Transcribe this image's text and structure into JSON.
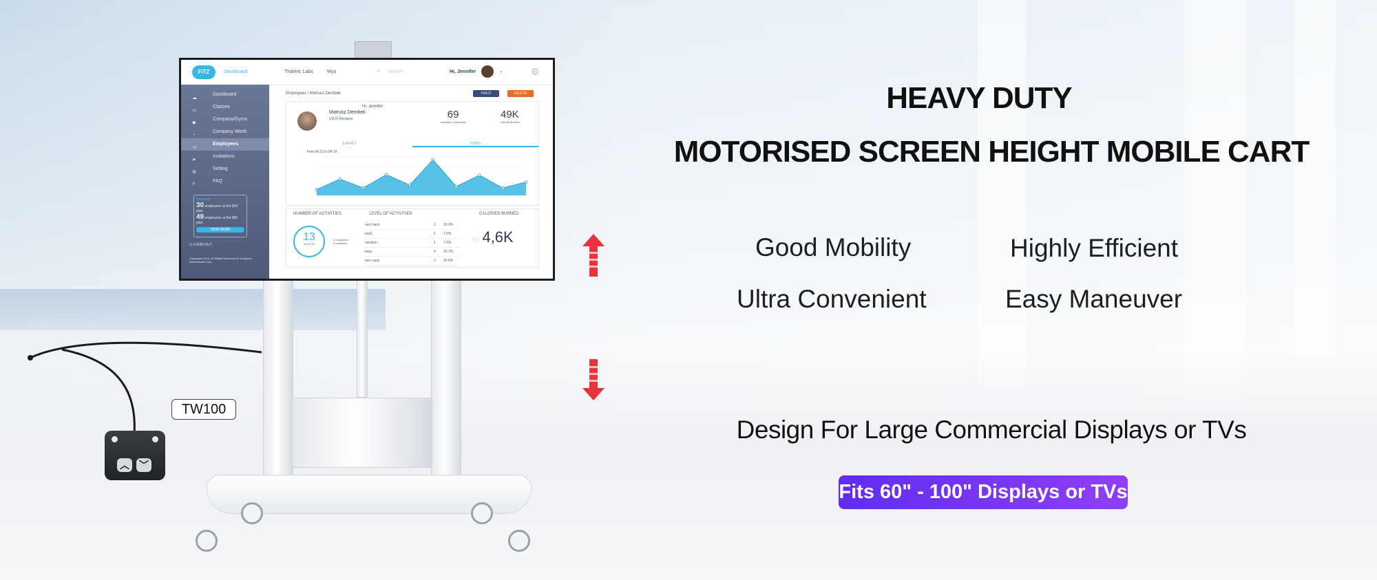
{
  "headline": {
    "line1": "HEAVY DUTY",
    "line2": "MOTORISED SCREEN HEIGHT MOBILE  CART"
  },
  "features": [
    "Good Mobility",
    "Highly Efficient",
    "Ultra Convenient",
    "Easy Maneuver"
  ],
  "design_text": "Design  For Large Commercial Displays or TVs",
  "badge_text": "Fits 60\" - 100\" Displays or TVs",
  "model_label": "TW100",
  "colors": {
    "arrow": "#e8323c",
    "badge": "#6a33f2",
    "accent": "#39b6e3"
  },
  "screen_ui": {
    "logo": "FITZ",
    "top_nav": {
      "dashboard": "Dashboard",
      "company": "Thalmic Labs",
      "company_suffix": "Myo",
      "search": "Search",
      "greeting": "Hi, Jennifer"
    },
    "sidebar": [
      "Dashboard",
      "Classes",
      "Company/Gyms",
      "Company Week",
      "Employees",
      "Invitations",
      "Setting",
      "FAQ"
    ],
    "plan": {
      "title": "Your plan",
      "count1": "30",
      "text1": "employees at the $50 plan",
      "count2": "49",
      "text2": "employees at the $50 plan",
      "button": "VIEW MORE"
    },
    "logout": "LOGIN OUT",
    "footer": "Copyrights 2015. All Rights Reserved by Energized International Corp.",
    "breadcrumb": "Employees / Matrusz Dembek",
    "buttons": {
      "hold": "HOLD",
      "delete": "DELETE"
    },
    "profile": {
      "greeting": "Hi, Jennifer",
      "name": "Matrusz Dembek",
      "role": "UI/UX Designer"
    },
    "kpis": [
      {
        "value": "69",
        "label": "Activities Completed"
      },
      {
        "value": "49K",
        "label": "Calories Burned"
      }
    ],
    "tabs": [
      "SURVEY",
      "STATS"
    ],
    "range": "from 04.13 to 04.19",
    "chart_values": [
      20,
      55,
      25,
      70,
      35,
      120,
      30,
      68,
      25,
      45
    ],
    "sections": [
      "NUMBER OF ACTIVITIES",
      "LEVEL OF ACTIVITIES",
      "CALORIES BURNED"
    ],
    "ring": {
      "value": "13",
      "sub": "out of 14"
    },
    "legend": [
      "completed",
      "cancelled"
    ],
    "levels": [
      {
        "level": "very hard",
        "n": "2",
        "pct": "15.3%"
      },
      {
        "level": "hard",
        "n": "1",
        "pct": "7.6%"
      },
      {
        "level": "medium",
        "n": "1",
        "pct": "7.6%"
      },
      {
        "level": "easy",
        "n": "4",
        "pct": "30.7%"
      },
      {
        "level": "very easy",
        "n": "2",
        "pct": "15.6%"
      }
    ],
    "calories": "4,6K"
  }
}
